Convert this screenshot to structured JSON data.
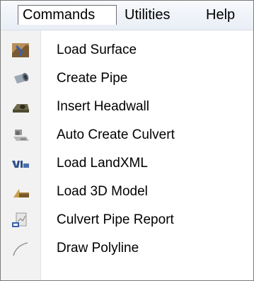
{
  "menubar": {
    "items": [
      {
        "label": "Commands"
      },
      {
        "label": "Utilities"
      },
      {
        "label": "Help"
      }
    ]
  },
  "commands_menu": {
    "items": [
      {
        "label": "Load Surface",
        "icon": "surface-icon"
      },
      {
        "label": "Create Pipe",
        "icon": "pipe-icon"
      },
      {
        "label": "Insert Headwall",
        "icon": "headwall-icon"
      },
      {
        "label": "Auto Create Culvert",
        "icon": "culvert-icon"
      },
      {
        "label": "Load LandXML",
        "icon": "landxml-icon"
      },
      {
        "label": "Load 3D Model",
        "icon": "model-3d-icon"
      },
      {
        "label": "Culvert Pipe Report",
        "icon": "report-icon"
      },
      {
        "label": "Draw Polyline",
        "icon": "polyline-icon"
      }
    ]
  }
}
